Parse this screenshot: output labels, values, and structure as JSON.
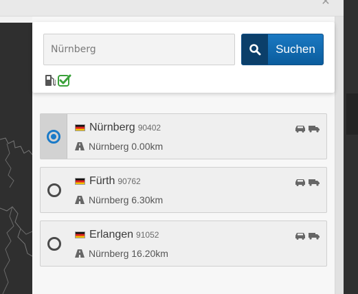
{
  "window": {
    "close_icon": "close-icon"
  },
  "search": {
    "input_value": "",
    "placeholder": "Nürnberg",
    "button_label": "Suchen",
    "button_icon": "search-icon"
  },
  "filters": [
    {
      "icon": "fuel-station-icon",
      "checked": true
    }
  ],
  "colors": {
    "accent": "#1a7ac8",
    "button_dark": "#0b3f6a",
    "check_green": "#3aa13a"
  },
  "results": [
    {
      "city": "Nürnberg",
      "plz": "90402",
      "distance": "Nürnberg 0.00km",
      "selected": true
    },
    {
      "city": "Fürth",
      "plz": "90762",
      "distance": "Nürnberg 6.30km",
      "selected": false
    },
    {
      "city": "Erlangen",
      "plz": "91052",
      "distance": "Nürnberg 16.20km",
      "selected": false
    }
  ]
}
